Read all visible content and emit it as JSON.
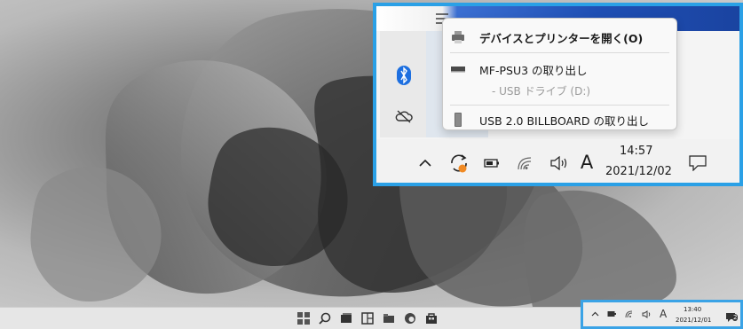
{
  "context_menu": {
    "open_devices": "デバイスとプリンターを開く(O)",
    "eject_psu3": "MF-PSU3 の取り出し",
    "usb_drive_sub": "- USB ドライブ (D:)",
    "eject_billboard": "USB 2.0 BILLBOARD の取り出し"
  },
  "zoomed_tray": {
    "time": "14:57",
    "date": "2021/12/02",
    "ime": "A"
  },
  "mini_tray": {
    "time": "13:40",
    "date": "2021/12/01",
    "ime": "A",
    "notification_count": "2"
  },
  "colors": {
    "highlight_border": "#2aa0e6",
    "bluetooth_blue": "#1d6fe0",
    "update_badge_orange": "#f08a24"
  }
}
